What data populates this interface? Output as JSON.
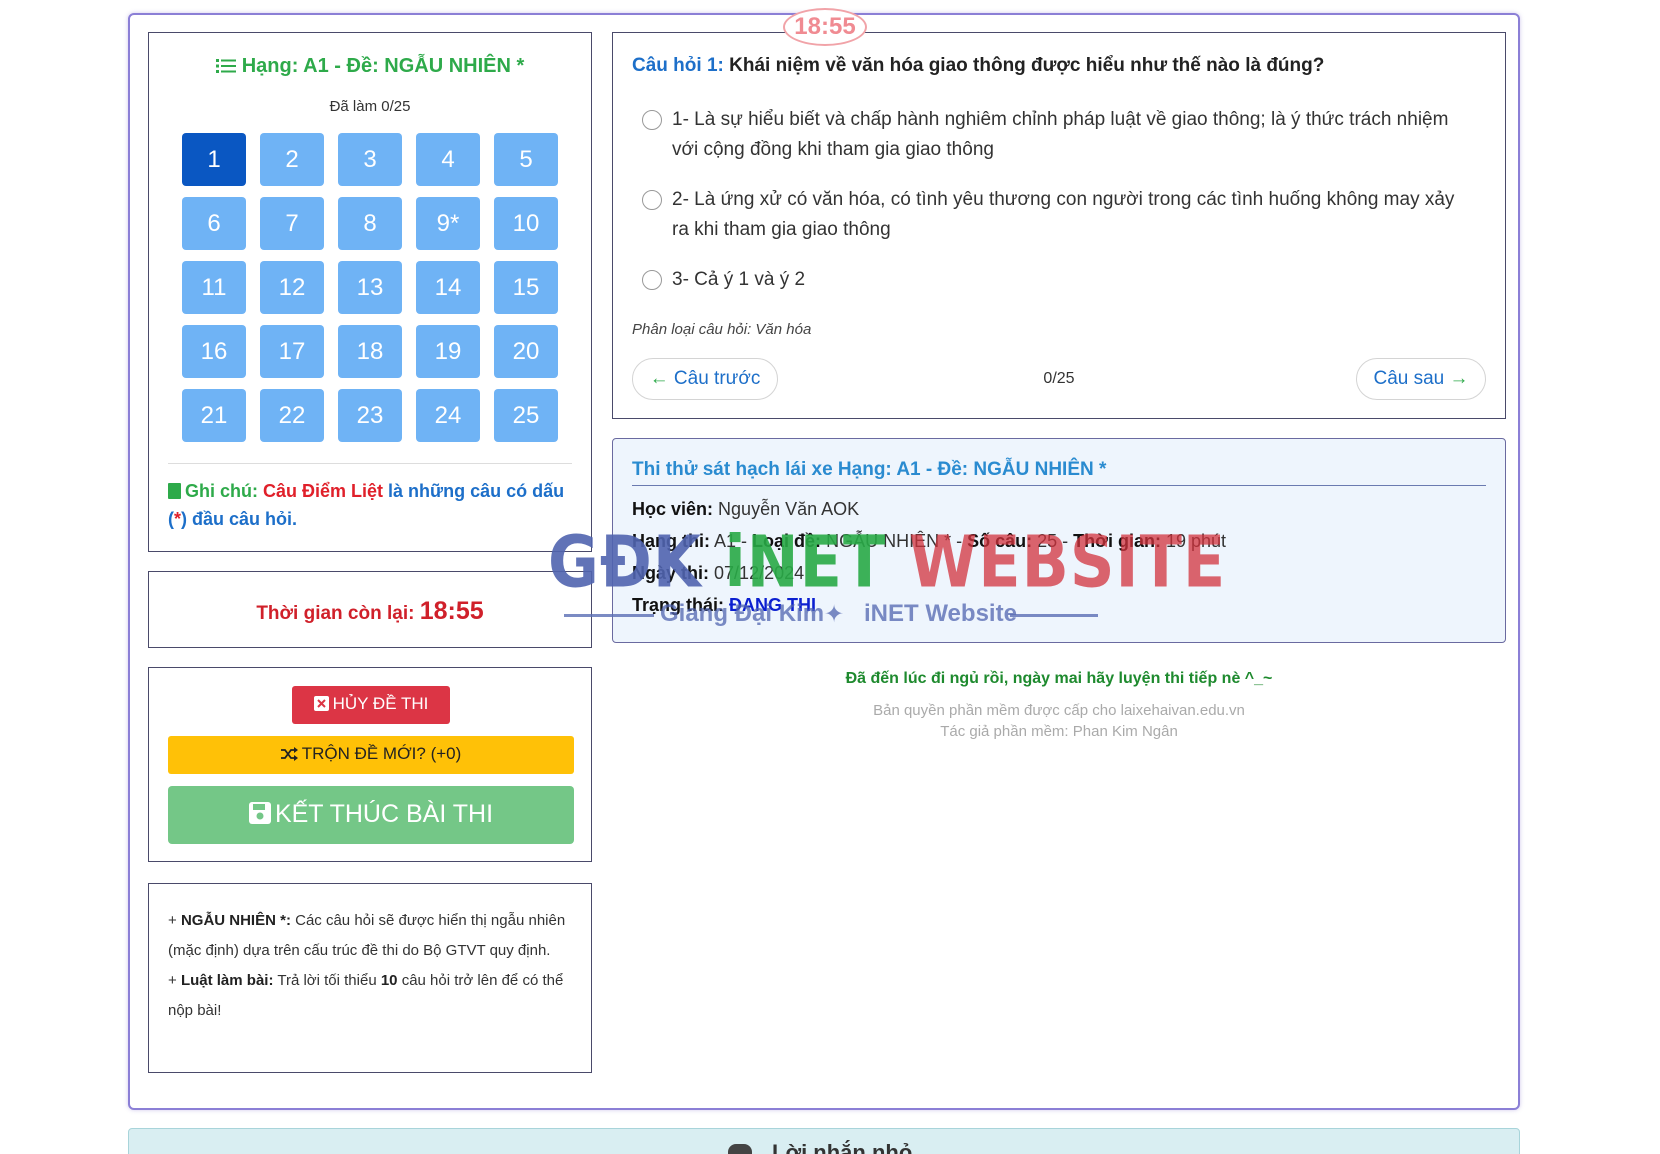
{
  "timer_badge": "18:55",
  "grid_panel": {
    "title": "Hạng: A1 - Đề: NGẪU NHIÊN *",
    "progress": "Đã làm 0/25",
    "questions": [
      "1",
      "2",
      "3",
      "4",
      "5",
      "6",
      "7",
      "8",
      "9*",
      "10",
      "11",
      "12",
      "13",
      "14",
      "15",
      "16",
      "17",
      "18",
      "19",
      "20",
      "21",
      "22",
      "23",
      "24",
      "25"
    ],
    "active_index": 0,
    "note_label": "Ghi chú:",
    "note_red": "Câu Điểm Liệt",
    "note_text": " là những câu có dấu (",
    "note_star": "*",
    "note_tail": ") đầu câu hỏi."
  },
  "timer_panel": {
    "label": "Thời gian còn lại:",
    "value": "18:55"
  },
  "actions": {
    "cancel_label": "HỦY ĐỀ THI",
    "shuffle_label": "TRỘN ĐỀ MỚI? (+0)",
    "finish_label": "KẾT THÚC BÀI THI"
  },
  "rules": {
    "r1_bold": "NGẪU NHIÊN *:",
    "r1_text": " Các câu hỏi sẽ được hiển thị ngẫu nhiên (mặc định) dựa trên cấu trúc đề thi do Bộ GTVT quy định.",
    "r2_bold": "Luật làm bài:",
    "r2_text_a": " Trả lời tối thiểu ",
    "r2_num": "10",
    "r2_text_b": " câu hỏi trở lên để có thể nộp bài!"
  },
  "question": {
    "number_label": "Câu hỏi 1:",
    "text": "Khái niệm về văn hóa giao thông được hiểu như thế nào là đúng?",
    "options": [
      "1- Là sự hiểu biết và chấp hành nghiêm chỉnh pháp luật về giao thông; là ý thức trách nhiệm với cộng đồng khi tham gia giao thông",
      "2- Là ứng xử có văn hóa, có tình yêu thương con người trong các tình huống không may xảy ra khi tham gia giao thông",
      "3- Cả ý 1 và ý 2"
    ],
    "category": "Phân loại câu hỏi: Văn hóa",
    "prev_label": "Câu trước",
    "next_label": "Câu sau",
    "counter": "0/25"
  },
  "info": {
    "title": "Thi thử sát hạch lái xe Hạng: A1 - Đề: NGẪU NHIÊN *",
    "student_label": "Học viên:",
    "student": "Nguyễn Văn AOK",
    "class_label": "Hạng thi:",
    "class": "A1",
    "type_label": "Loại đề:",
    "type": "NGẪU NHIÊN *",
    "count_label": "Số câu:",
    "count": "25",
    "time_label": "Thời gian:",
    "time": "19 phút",
    "date_label": "Ngày thi:",
    "date": "07/12/2024",
    "status_label": "Trạng thái:",
    "status": "ĐANG THI"
  },
  "watermark": {
    "part1": "GĐK ",
    "part2": "iNET ",
    "part3": "WEBSITE",
    "sub1": "Giang Đại Kim",
    "sub2": "iNET Website"
  },
  "message": "Đã đến lúc đi ngủ rồi, ngày mai hãy luyện thi tiếp nè ^_~",
  "copyright": "Bản quyền phần mềm được cấp cho laixehaivan.edu.vn",
  "author": "Tác giả phần mềm: Phan Kim Ngân",
  "footer_text": "Lời nhắn nhỏ",
  "colors": {
    "accent_blue": "#1d6fc9",
    "accent_green": "#2eaa4a",
    "danger": "#dc3545",
    "warning": "#ffc107",
    "success": "#74c787",
    "grid_button": "#6fb3f5",
    "grid_button_active": "#0a57c2"
  }
}
